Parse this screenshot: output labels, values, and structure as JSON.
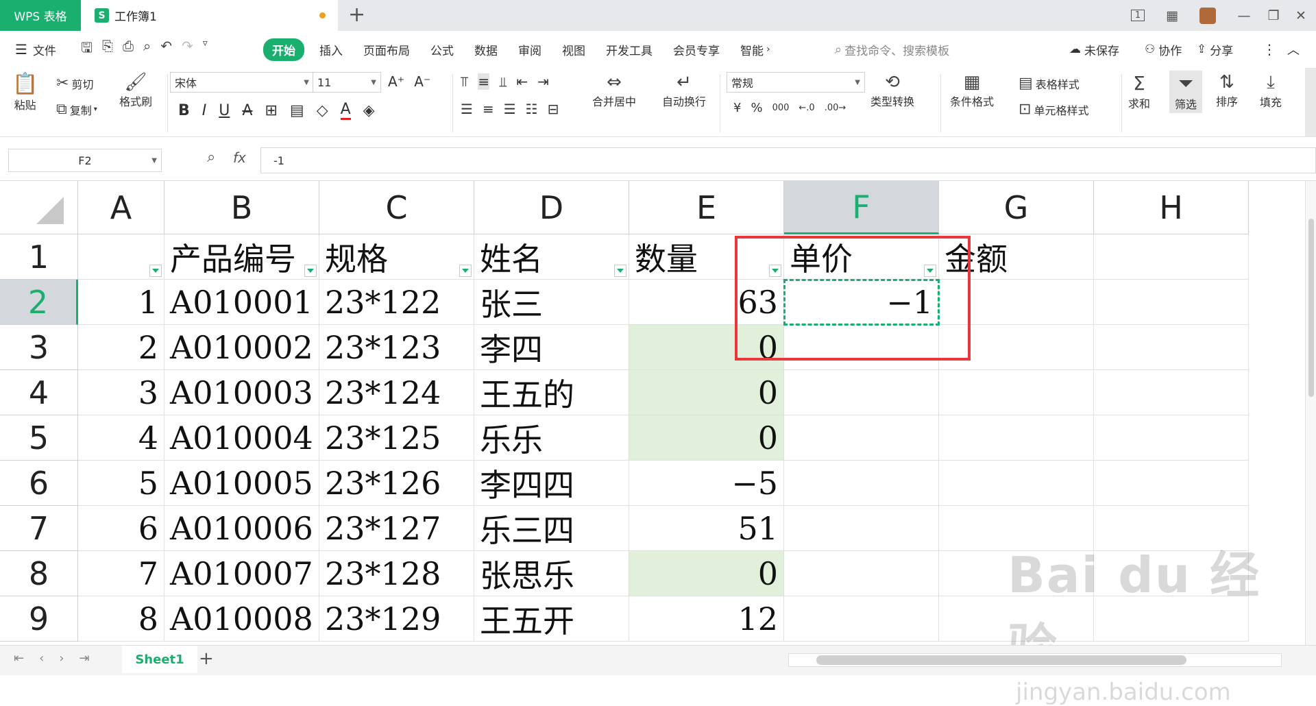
{
  "titlebar": {
    "app_tab": "WPS 表格",
    "doc_icon": "S",
    "doc_title": "工作簿1",
    "new_tab": "+",
    "page_indicator": "1"
  },
  "menubar": {
    "file": "文件",
    "tabs": [
      "开始",
      "插入",
      "页面布局",
      "公式",
      "数据",
      "审阅",
      "视图",
      "开发工具",
      "会员专享",
      "智能"
    ],
    "search_placeholder": "查找命令、搜索模板",
    "unsaved": "未保存",
    "collab": "协作",
    "share": "分享"
  },
  "toolbar": {
    "paste": "粘贴",
    "cut": "剪切",
    "copy": "复制",
    "format_painter": "格式刷",
    "font_name": "宋体",
    "font_size": "11",
    "merge_center": "合并居中",
    "wrap_text": "自动换行",
    "number_format": "常规",
    "type_convert": "类型转换",
    "cond_format": "条件格式",
    "table_style": "表格样式",
    "cell_style": "单元格样式",
    "sum": "求和",
    "filter": "筛选",
    "sort": "排序",
    "fill": "填充",
    "currency": "¥",
    "percent": "%",
    "thousands": "000"
  },
  "formulabar": {
    "cell_ref": "F2",
    "fx": "fx",
    "value": "-1"
  },
  "grid": {
    "columns": [
      "A",
      "B",
      "C",
      "D",
      "E",
      "F",
      "G",
      "H"
    ],
    "active_column": "F",
    "active_row": "2",
    "rows": [
      "1",
      "2",
      "3",
      "4",
      "5",
      "6",
      "7",
      "8",
      "9"
    ],
    "header_row": [
      "",
      "产品编号",
      "规格",
      "姓名",
      "数量",
      "单价",
      "金额",
      ""
    ],
    "data": [
      [
        "1",
        "A010001",
        "23*122",
        "张三",
        "63",
        "−1"
      ],
      [
        "2",
        "A010002",
        "23*123",
        "李四",
        "0",
        ""
      ],
      [
        "3",
        "A010003",
        "23*124",
        "王五的",
        "0",
        ""
      ],
      [
        "4",
        "A010004",
        "23*125",
        "乐乐",
        "0",
        ""
      ],
      [
        "5",
        "A010005",
        "23*126",
        "李四四",
        "−5",
        ""
      ],
      [
        "6",
        "A010006",
        "23*127",
        "乐三四",
        "51",
        ""
      ],
      [
        "7",
        "A010007",
        "23*128",
        "张思乐",
        "0",
        ""
      ],
      [
        "8",
        "A010008",
        "23*129",
        "王五开",
        "12",
        ""
      ]
    ],
    "highlight_color": "#e2efda",
    "selection_color": "#1aae6f",
    "annotation_color": "#e8383d"
  },
  "statusbar": {
    "sheet_name": "Sheet1",
    "add_sheet": "+"
  },
  "watermark": {
    "brand": "Bai du 经验",
    "url": "jingyan.baidu.com"
  }
}
